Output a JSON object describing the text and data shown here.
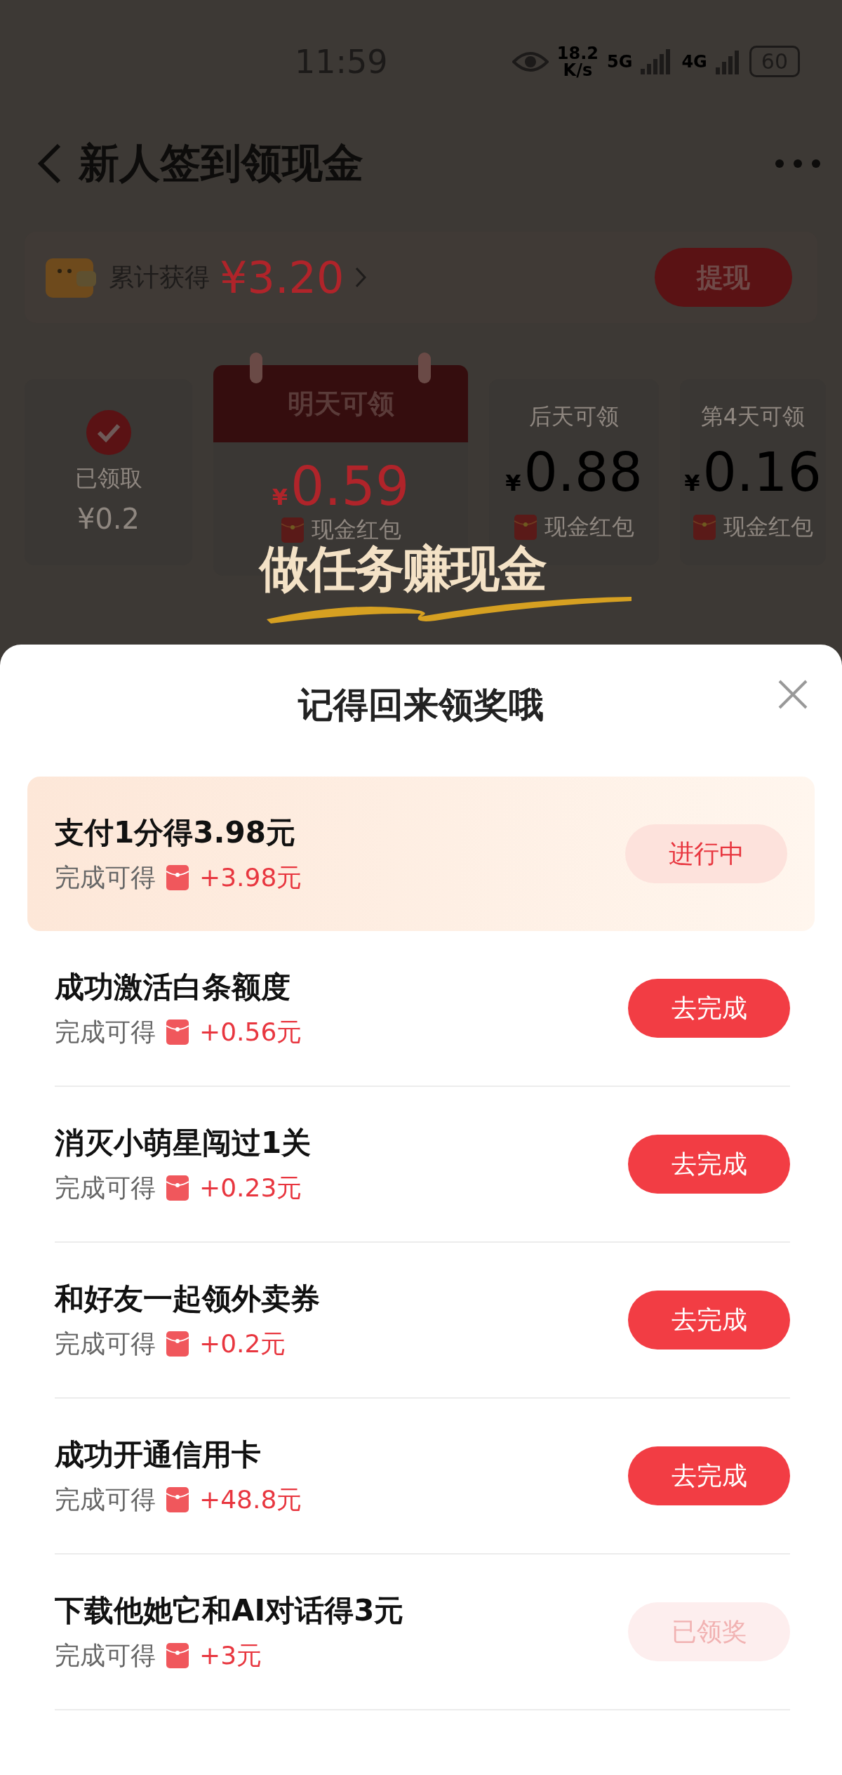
{
  "status_bar": {
    "time": "11:59",
    "speed_value": "18.2",
    "speed_unit": "K/s",
    "network_1": "5G",
    "network_2": "4G",
    "battery": "60"
  },
  "nav": {
    "title": "新人签到领现金"
  },
  "summary": {
    "label": "累计获得",
    "amount": "¥3.20",
    "button": "提现"
  },
  "days": [
    {
      "kind": "claimed",
      "label": "已领取",
      "amount": "¥0.2"
    },
    {
      "kind": "featured",
      "label": "明天可领",
      "currency": "¥",
      "amount": "0.59",
      "reward": "现金红包"
    },
    {
      "kind": "upcoming",
      "label": "后天可领",
      "currency": "¥",
      "amount": "0.88",
      "reward": "现金红包"
    },
    {
      "kind": "upcoming",
      "label": "第4天可领",
      "currency": "¥",
      "amount": "0.16",
      "reward": "现金红包"
    }
  ],
  "banner": "做任务赚现金",
  "sheet": {
    "title": "记得回来领奖哦",
    "tasks": [
      {
        "kind": "in_progress",
        "title": "支付1分得3.98元",
        "caption": "完成可得",
        "reward": "+3.98元",
        "button": "进行中"
      },
      {
        "kind": "todo",
        "title": "成功激活白条额度",
        "caption": "完成可得",
        "reward": "+0.56元",
        "button": "去完成"
      },
      {
        "kind": "todo",
        "title": "消灭小萌星闯过1关",
        "caption": "完成可得",
        "reward": "+0.23元",
        "button": "去完成"
      },
      {
        "kind": "todo",
        "title": "和好友一起领外卖券",
        "caption": "完成可得",
        "reward": "+0.2元",
        "button": "去完成"
      },
      {
        "kind": "todo",
        "title": "成功开通信用卡",
        "caption": "完成可得",
        "reward": "+48.8元",
        "button": "去完成"
      },
      {
        "kind": "claimed",
        "title": "下载他她它和AI对话得3元",
        "caption": "完成可得",
        "reward": "+3元",
        "button": "已领奖"
      }
    ]
  }
}
